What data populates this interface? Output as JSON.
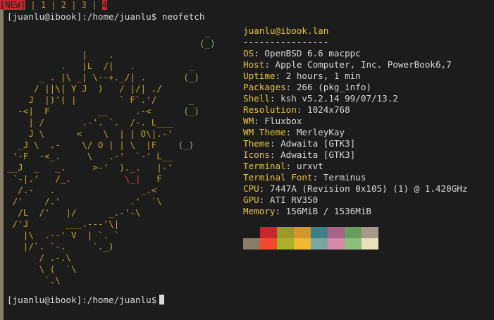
{
  "tabbar": {
    "tabs": [
      {
        "label": "[NEW]",
        "state": "new"
      },
      {
        "label": "1",
        "state": "normal"
      },
      {
        "label": "2",
        "state": "normal"
      },
      {
        "label": "3",
        "state": "normal"
      },
      {
        "label": "4",
        "state": "active"
      }
    ]
  },
  "terminal": {
    "prompt": "[juanlu@ibook]:/home/juanlu$",
    "command": "neofetch",
    "final_prompt": "[juanlu@ibook]:/home/juanlu$"
  },
  "neofetch": {
    "header": "juanlu@ibook.lan",
    "underline": "----------------",
    "fields": [
      {
        "key": "OS",
        "value": "OpenBSD 6.6 macppc"
      },
      {
        "key": "Host",
        "value": "Apple Computer, Inc. PowerBook6,7"
      },
      {
        "key": "Uptime",
        "value": "2 hours, 1 min"
      },
      {
        "key": "Packages",
        "value": "266 (pkg_info)"
      },
      {
        "key": "Shell",
        "value": "ksh v5.2.14 99/07/13.2"
      },
      {
        "key": "Resolution",
        "value": "1024x768"
      },
      {
        "key": "WM",
        "value": "Fluxbox"
      },
      {
        "key": "WM Theme",
        "value": "MerleyKay"
      },
      {
        "key": "Theme",
        "value": "Adwaita [GTK3]"
      },
      {
        "key": "Icons",
        "value": "Adwaita [GTK3]"
      },
      {
        "key": "Terminal",
        "value": "urxvt"
      },
      {
        "key": "Terminal Font",
        "value": "Terminus"
      },
      {
        "key": "CPU",
        "value": "7447A (Revision 0x105) (1) @ 1.420GHz"
      },
      {
        "key": "GPU",
        "value": "ATI RV350"
      },
      {
        "key": "Memory",
        "value": "156MiB / 1536MiB"
      }
    ],
    "palette_row1": [
      "#1c1c1c",
      "#c8262c",
      "#9a9a2a",
      "#d4962a",
      "#3e8088",
      "#a8628a",
      "#6a9c5e",
      "#a89a88"
    ],
    "palette_row2": [
      "#8a7d66",
      "#f24a2e",
      "#a9b02a",
      "#f0b82e",
      "#7aa8a0",
      "#d48aa8",
      "#8cc07a",
      "#ece0b8"
    ]
  }
}
